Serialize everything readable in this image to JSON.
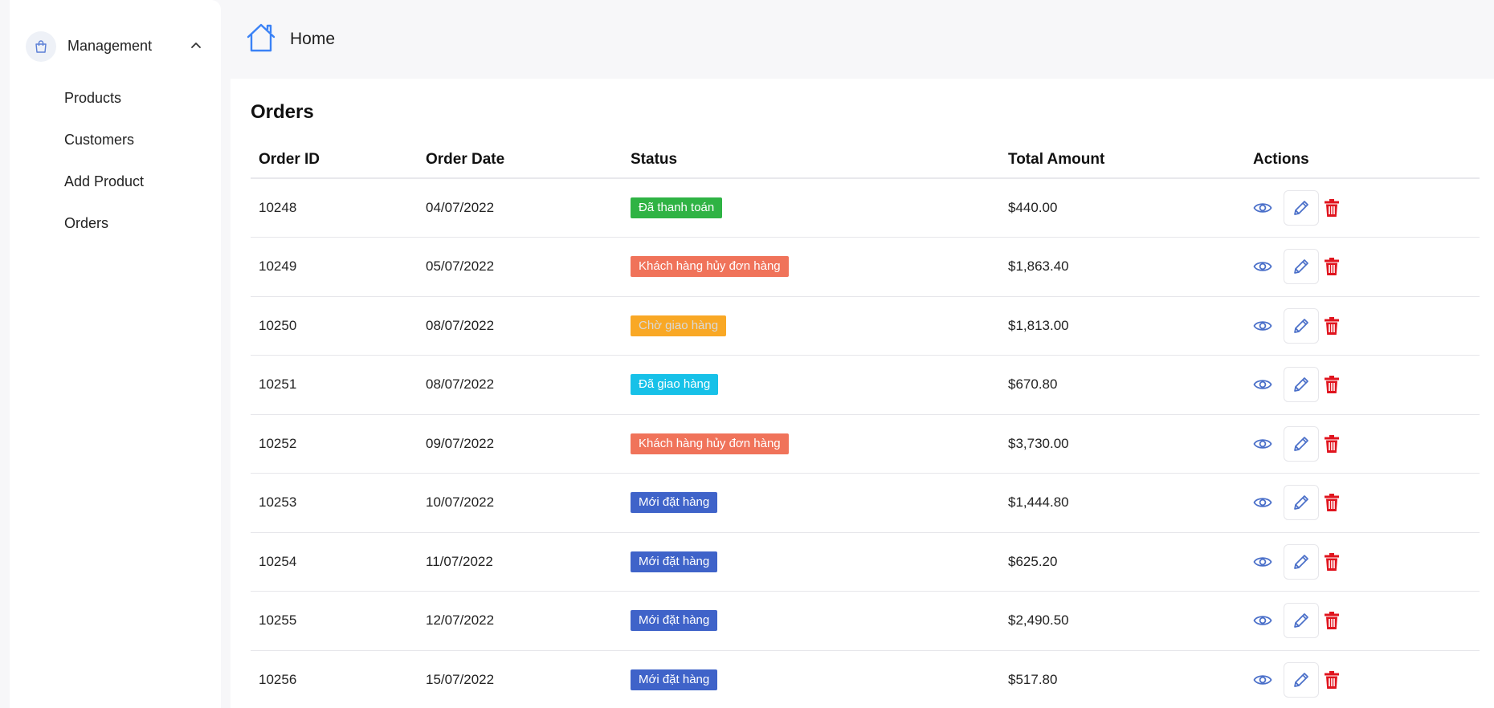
{
  "sidebar": {
    "group_label": "Management",
    "group_icon": "shopping-bag-icon",
    "items": [
      {
        "label": "Products"
      },
      {
        "label": "Customers"
      },
      {
        "label": "Add Product"
      },
      {
        "label": "Orders"
      }
    ]
  },
  "topbar": {
    "home_label": "Home",
    "home_icon": "home-icon"
  },
  "orders": {
    "title": "Orders",
    "columns": [
      "Order ID",
      "Order Date",
      "Status",
      "Total Amount",
      "Actions"
    ],
    "rows": [
      {
        "id": "10248",
        "date": "04/07/2022",
        "status": "Đã thanh toán",
        "status_color": "#2fb344",
        "status_text_color": "#ffffff",
        "total": "$440.00"
      },
      {
        "id": "10249",
        "date": "05/07/2022",
        "status": "Khách hàng hủy đơn hàng",
        "status_color": "#f0735a",
        "status_text_color": "#ffffff",
        "total": "$1,863.40"
      },
      {
        "id": "10250",
        "date": "08/07/2022",
        "status": "Chờ giao hàng",
        "status_color": "#f9a825",
        "status_text_color": "#d9d9d9",
        "total": "$1,813.00"
      },
      {
        "id": "10251",
        "date": "08/07/2022",
        "status": "Đã giao hàng",
        "status_color": "#17c1e8",
        "status_text_color": "#ffffff",
        "total": "$670.80"
      },
      {
        "id": "10252",
        "date": "09/07/2022",
        "status": "Khách hàng hủy đơn hàng",
        "status_color": "#f0735a",
        "status_text_color": "#ffffff",
        "total": "$3,730.00"
      },
      {
        "id": "10253",
        "date": "10/07/2022",
        "status": "Mới đặt hàng",
        "status_color": "#3f63c9",
        "status_text_color": "#ffffff",
        "total": "$1,444.80"
      },
      {
        "id": "10254",
        "date": "11/07/2022",
        "status": "Mới đặt hàng",
        "status_color": "#3f63c9",
        "status_text_color": "#ffffff",
        "total": "$625.20"
      },
      {
        "id": "10255",
        "date": "12/07/2022",
        "status": "Mới đặt hàng",
        "status_color": "#3f63c9",
        "status_text_color": "#ffffff",
        "total": "$2,490.50"
      },
      {
        "id": "10256",
        "date": "15/07/2022",
        "status": "Mới đặt hàng",
        "status_color": "#3f63c9",
        "status_text_color": "#ffffff",
        "total": "$517.80"
      }
    ],
    "action_icons": [
      "eye-icon",
      "pencil-icon",
      "trash-icon"
    ]
  },
  "colors": {
    "accent": "#4a6fc9",
    "delete": "#e0141e",
    "home_icon": "#3b82f6"
  }
}
